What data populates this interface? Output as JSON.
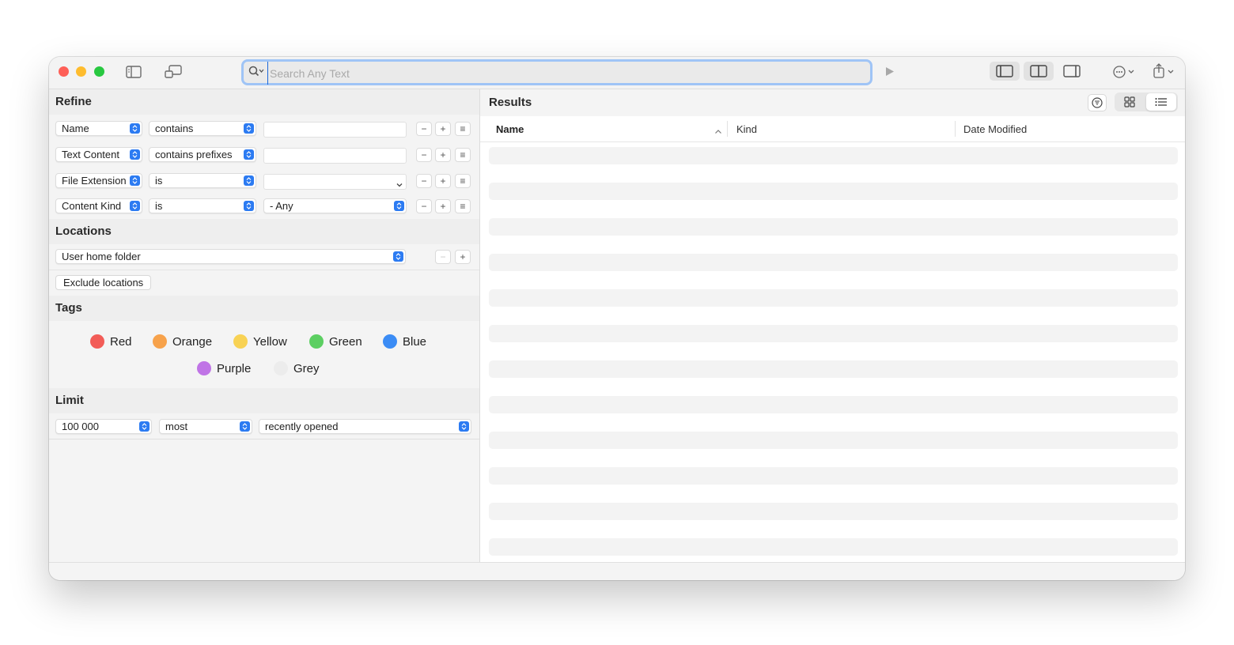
{
  "toolbar": {
    "search_placeholder": "Search Any Text",
    "search_value": ""
  },
  "refine": {
    "title": "Refine",
    "rows": [
      {
        "attribute": "Name",
        "operator": "contains",
        "value": ""
      },
      {
        "attribute": "Text Content",
        "operator": "contains prefixes",
        "value": ""
      },
      {
        "attribute": "File Extension",
        "operator": "is",
        "value": ""
      },
      {
        "attribute": "Content Kind",
        "operator": "is",
        "value": "- Any"
      }
    ],
    "minus": "−",
    "plus": "+",
    "options": "≡"
  },
  "locations": {
    "title": "Locations",
    "selected": "User home folder",
    "exclude_label": "Exclude locations"
  },
  "tags": {
    "title": "Tags",
    "items": [
      {
        "label": "Red",
        "color": "#f25c57"
      },
      {
        "label": "Orange",
        "color": "#f7a24b"
      },
      {
        "label": "Yellow",
        "color": "#f8d254"
      },
      {
        "label": "Green",
        "color": "#5ccf62"
      },
      {
        "label": "Blue",
        "color": "#3b8cf5"
      },
      {
        "label": "Purple",
        "color": "#c074e6"
      },
      {
        "label": "Grey",
        "color": "#ececec"
      }
    ]
  },
  "limit": {
    "title": "Limit",
    "count": "100 000",
    "order": "most",
    "criterion": "recently opened"
  },
  "results": {
    "title": "Results",
    "columns": {
      "name": "Name",
      "kind": "Kind",
      "date_modified": "Date Modified"
    }
  },
  "colors": {
    "accent": "#2c7bf2",
    "close": "#fe5f57",
    "minimize": "#febc2e",
    "zoom": "#28c840"
  }
}
